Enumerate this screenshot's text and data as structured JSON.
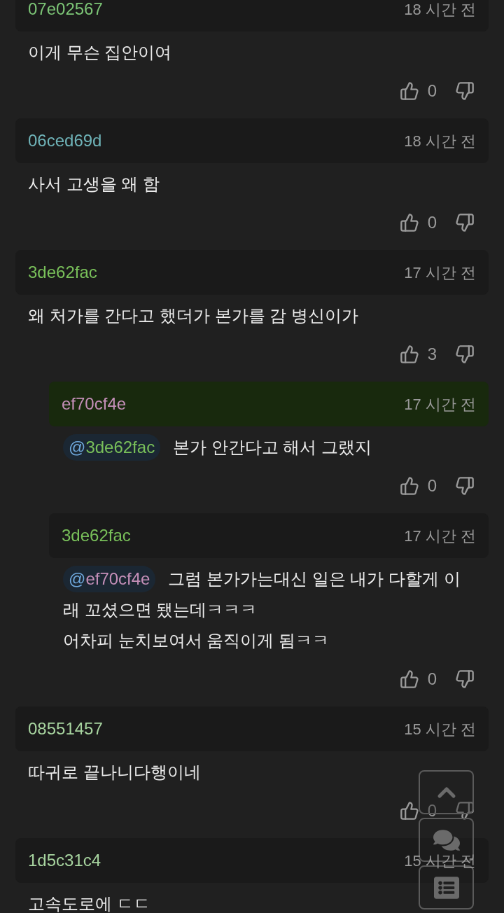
{
  "comments": [
    {
      "author": "07e02567",
      "color": "#7cc576",
      "time": "18 시간 전",
      "lines": [
        "이게 무슨 집안이여"
      ],
      "likes": "0",
      "highlighted": false
    },
    {
      "author": "06ced69d",
      "color": "#6fb3b8",
      "time": "18 시간 전",
      "lines": [
        "사서 고생을 왜 함"
      ],
      "likes": "0",
      "highlighted": false
    },
    {
      "author": "3de62fac",
      "color": "#79c05a",
      "time": "17 시간 전",
      "lines": [
        "왜 처가를 간다고 했더가 본가를 감 병신이가"
      ],
      "likes": "3",
      "highlighted": false,
      "replies": [
        {
          "author": "ef70cf4e",
          "color": "#c48fb8",
          "time": "17 시간 전",
          "highlighted": true,
          "mention": {
            "symbol": "@",
            "user": "3de62fac",
            "color": "#79c05a"
          },
          "lines": [
            "본가 안간다고 해서 그랬지"
          ],
          "likes": "0"
        },
        {
          "author": "3de62fac",
          "color": "#79c05a",
          "time": "17 시간 전",
          "highlighted": false,
          "mention": {
            "symbol": "@",
            "user": "ef70cf4e",
            "color": "#c48fb8"
          },
          "lines": [
            "그럼 본가가는대신 일은 내가 다할게 이",
            "래 꼬셨으면 됐는데ㅋㅋㅋ",
            "어차피 눈치보여서 움직이게 됨ㅋㅋ"
          ],
          "likes": "0"
        }
      ]
    },
    {
      "author": "08551457",
      "color": "#a8d5a0",
      "time": "15 시간 전",
      "lines": [
        "따귀로 끝나니다행이네"
      ],
      "likes": "0",
      "highlighted": false
    },
    {
      "author": "1d5c31c4",
      "color": "#a8d5a0",
      "time": "15 시간 전",
      "lines": [
        "고속도로에 ㄷㄷ"
      ],
      "highlighted": false
    }
  ]
}
